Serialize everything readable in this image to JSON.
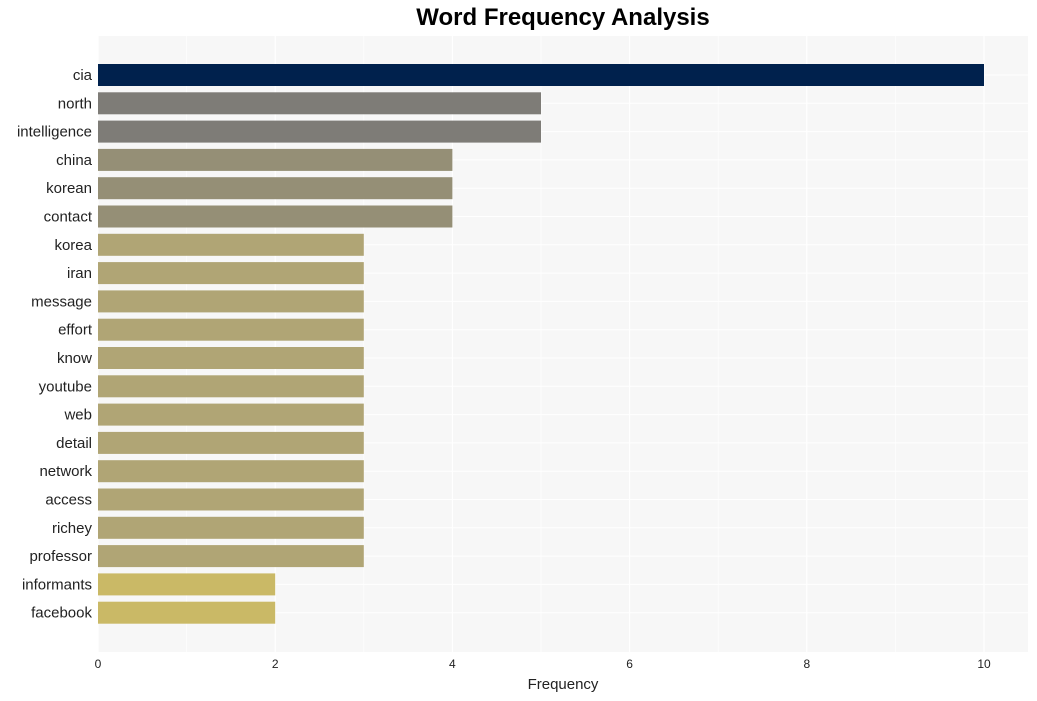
{
  "chart_data": {
    "type": "bar",
    "orientation": "horizontal",
    "title": "Word Frequency Analysis",
    "xlabel": "Frequency",
    "ylabel": "",
    "xlim": [
      0,
      10.5
    ],
    "xticks": [
      0,
      2,
      4,
      6,
      8,
      10
    ],
    "grid": true,
    "categories": [
      "cia",
      "north",
      "intelligence",
      "china",
      "korean",
      "contact",
      "korea",
      "iran",
      "message",
      "effort",
      "know",
      "youtube",
      "web",
      "detail",
      "network",
      "access",
      "richey",
      "professor",
      "informants",
      "facebook"
    ],
    "values": [
      10,
      5,
      5,
      4,
      4,
      4,
      3,
      3,
      3,
      3,
      3,
      3,
      3,
      3,
      3,
      3,
      3,
      3,
      2,
      2
    ],
    "colors": {
      "10": "#00214d",
      "5": "#7e7c77",
      "4": "#958f76",
      "3": "#b0a575",
      "2": "#cab966"
    },
    "plot_background": "#f7f7f7"
  }
}
